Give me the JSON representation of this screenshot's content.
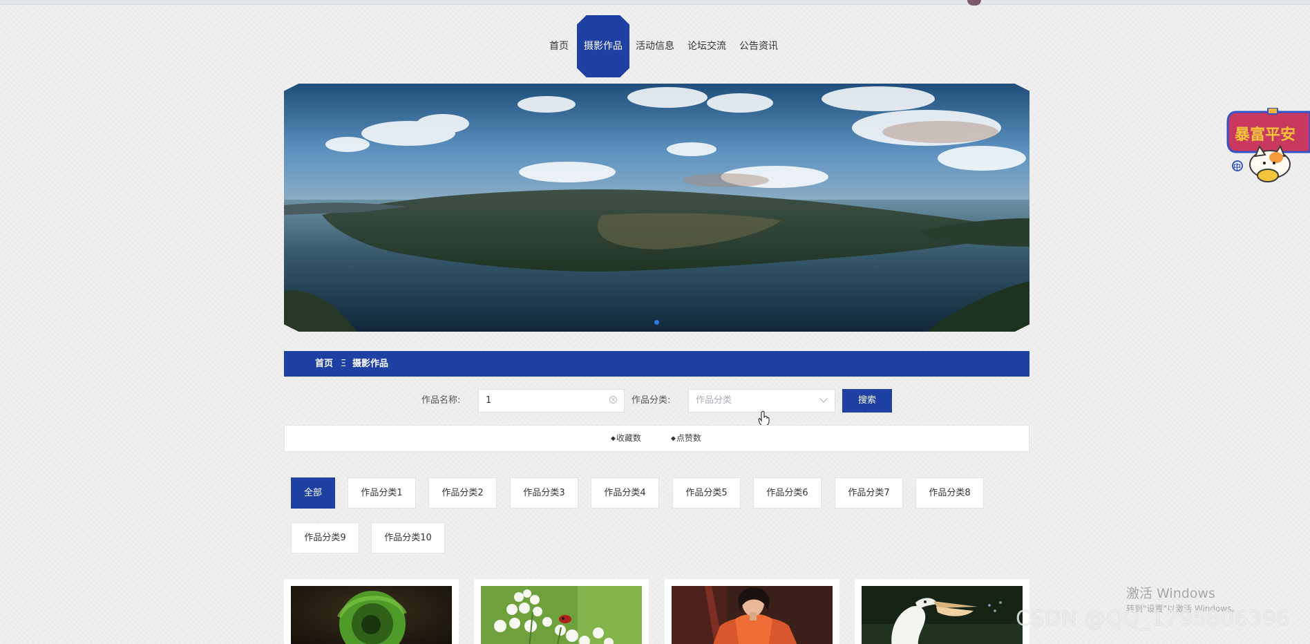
{
  "nav": {
    "items": [
      {
        "label": "首页",
        "active": false
      },
      {
        "label": "摄影作品",
        "active": true
      },
      {
        "label": "活动信息",
        "active": false
      },
      {
        "label": "论坛交流",
        "active": false
      },
      {
        "label": "公告资讯",
        "active": false
      }
    ]
  },
  "breadcrumb": {
    "home": "首页",
    "separator": "Ξ",
    "current": "摄影作品"
  },
  "search": {
    "name_label": "作品名称:",
    "name_value": "1",
    "category_label": "作品分类:",
    "category_placeholder": "作品分类",
    "button_label": "搜索"
  },
  "sort": {
    "favorites": "收藏数",
    "likes": "点赞数"
  },
  "categories": [
    {
      "label": "全部",
      "active": true
    },
    {
      "label": "作品分类1"
    },
    {
      "label": "作品分类2"
    },
    {
      "label": "作品分类3"
    },
    {
      "label": "作品分类4"
    },
    {
      "label": "作品分类5"
    },
    {
      "label": "作品分类6"
    },
    {
      "label": "作品分类7"
    },
    {
      "label": "作品分类8"
    },
    {
      "label": "作品分类9"
    },
    {
      "label": "作品分类10"
    }
  ],
  "cards": [
    {
      "image": "green-chameleon-tail"
    },
    {
      "image": "white-flowers-ladybug"
    },
    {
      "image": "woman-red-hanfu"
    },
    {
      "image": "pelican-on-water"
    }
  ],
  "promo": {
    "text": "暴富平安",
    "badge": "中"
  },
  "watermarks": {
    "windows_title": "激活 Windows",
    "windows_subtitle": "转到\"设置\"以激活 Windows。",
    "csdn": "CSDN @QQ_1795806396"
  },
  "colors": {
    "primary": "#1f40a3",
    "background": "#f0f0f0",
    "card": "#ffffff"
  }
}
